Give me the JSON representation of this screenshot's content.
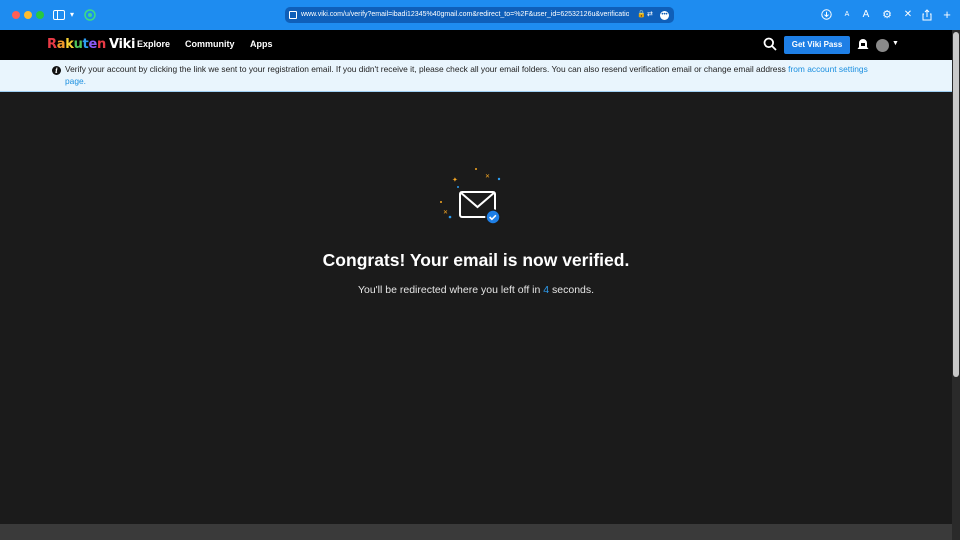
{
  "browser": {
    "url": "www.viki.com/u/verify?email=ibadi12345%40gmail.com&redirect_to=%2F&user_id=62532126u&verification",
    "font_small": "A",
    "font_large": "A"
  },
  "nav": {
    "logo_letters": [
      "R",
      "a",
      "k",
      "u",
      "t",
      "e",
      "n"
    ],
    "logo_viki": "Viki",
    "explore": "Explore",
    "community": "Community",
    "apps": "Apps",
    "pass_button": "Get Viki Pass"
  },
  "banner": {
    "text": "Verify your account by clicking the link we sent to your registration email. If you didn't receive it, please check all your email folders. You can also resend verification email or change email address ",
    "link": "from account settings page."
  },
  "main": {
    "title": "Congrats! Your email is now verified.",
    "subtitle_before": "You'll be redirected where you left off in ",
    "countdown": "4",
    "subtitle_after": " seconds."
  },
  "colors": {
    "accent": "#1e7fe6",
    "browser_bar": "#1e8cf0",
    "banner_bg": "#e9f5fd",
    "page_bg": "#1b1b1b"
  }
}
